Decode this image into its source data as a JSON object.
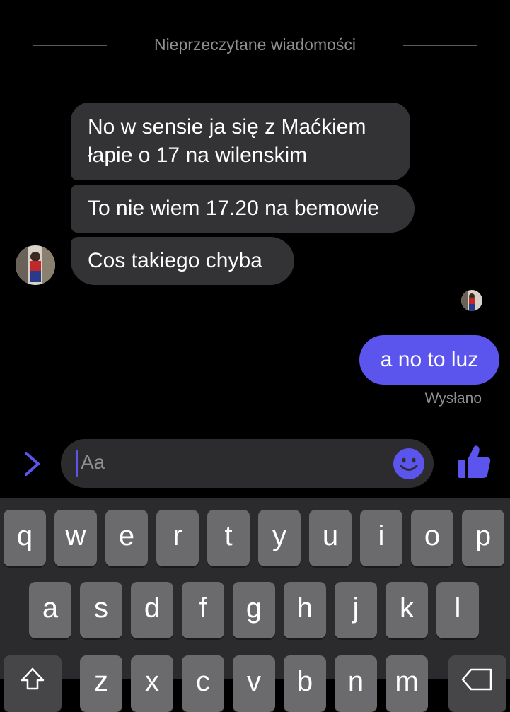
{
  "divider": {
    "label": "Nieprzeczytane wiadomości"
  },
  "incoming": [
    {
      "lines": [
        "No w sensie ja się z Maćkiem",
        "łapie o 17 na wilenskim"
      ]
    },
    {
      "lines": [
        "To nie wiem 17.20 na bemowie"
      ]
    },
    {
      "lines": [
        "Cos takiego chyba"
      ]
    }
  ],
  "outgoing": {
    "text": "a no to luz",
    "status": "Wysłano"
  },
  "composer": {
    "placeholder": "Aa"
  },
  "keyboard": {
    "row1": [
      "q",
      "w",
      "e",
      "r",
      "t",
      "y",
      "u",
      "i",
      "o",
      "p"
    ],
    "row2": [
      "a",
      "s",
      "d",
      "f",
      "g",
      "h",
      "j",
      "k",
      "l"
    ],
    "row3": [
      "z",
      "x",
      "c",
      "v",
      "b",
      "n",
      "m"
    ]
  },
  "colors": {
    "accent": "#5b55ee",
    "incoming_bubble": "#333335",
    "background": "#000000"
  },
  "icons": {
    "expand": "chevron-right-icon",
    "emoji": "smiley-icon",
    "like": "thumbs-up-icon"
  }
}
